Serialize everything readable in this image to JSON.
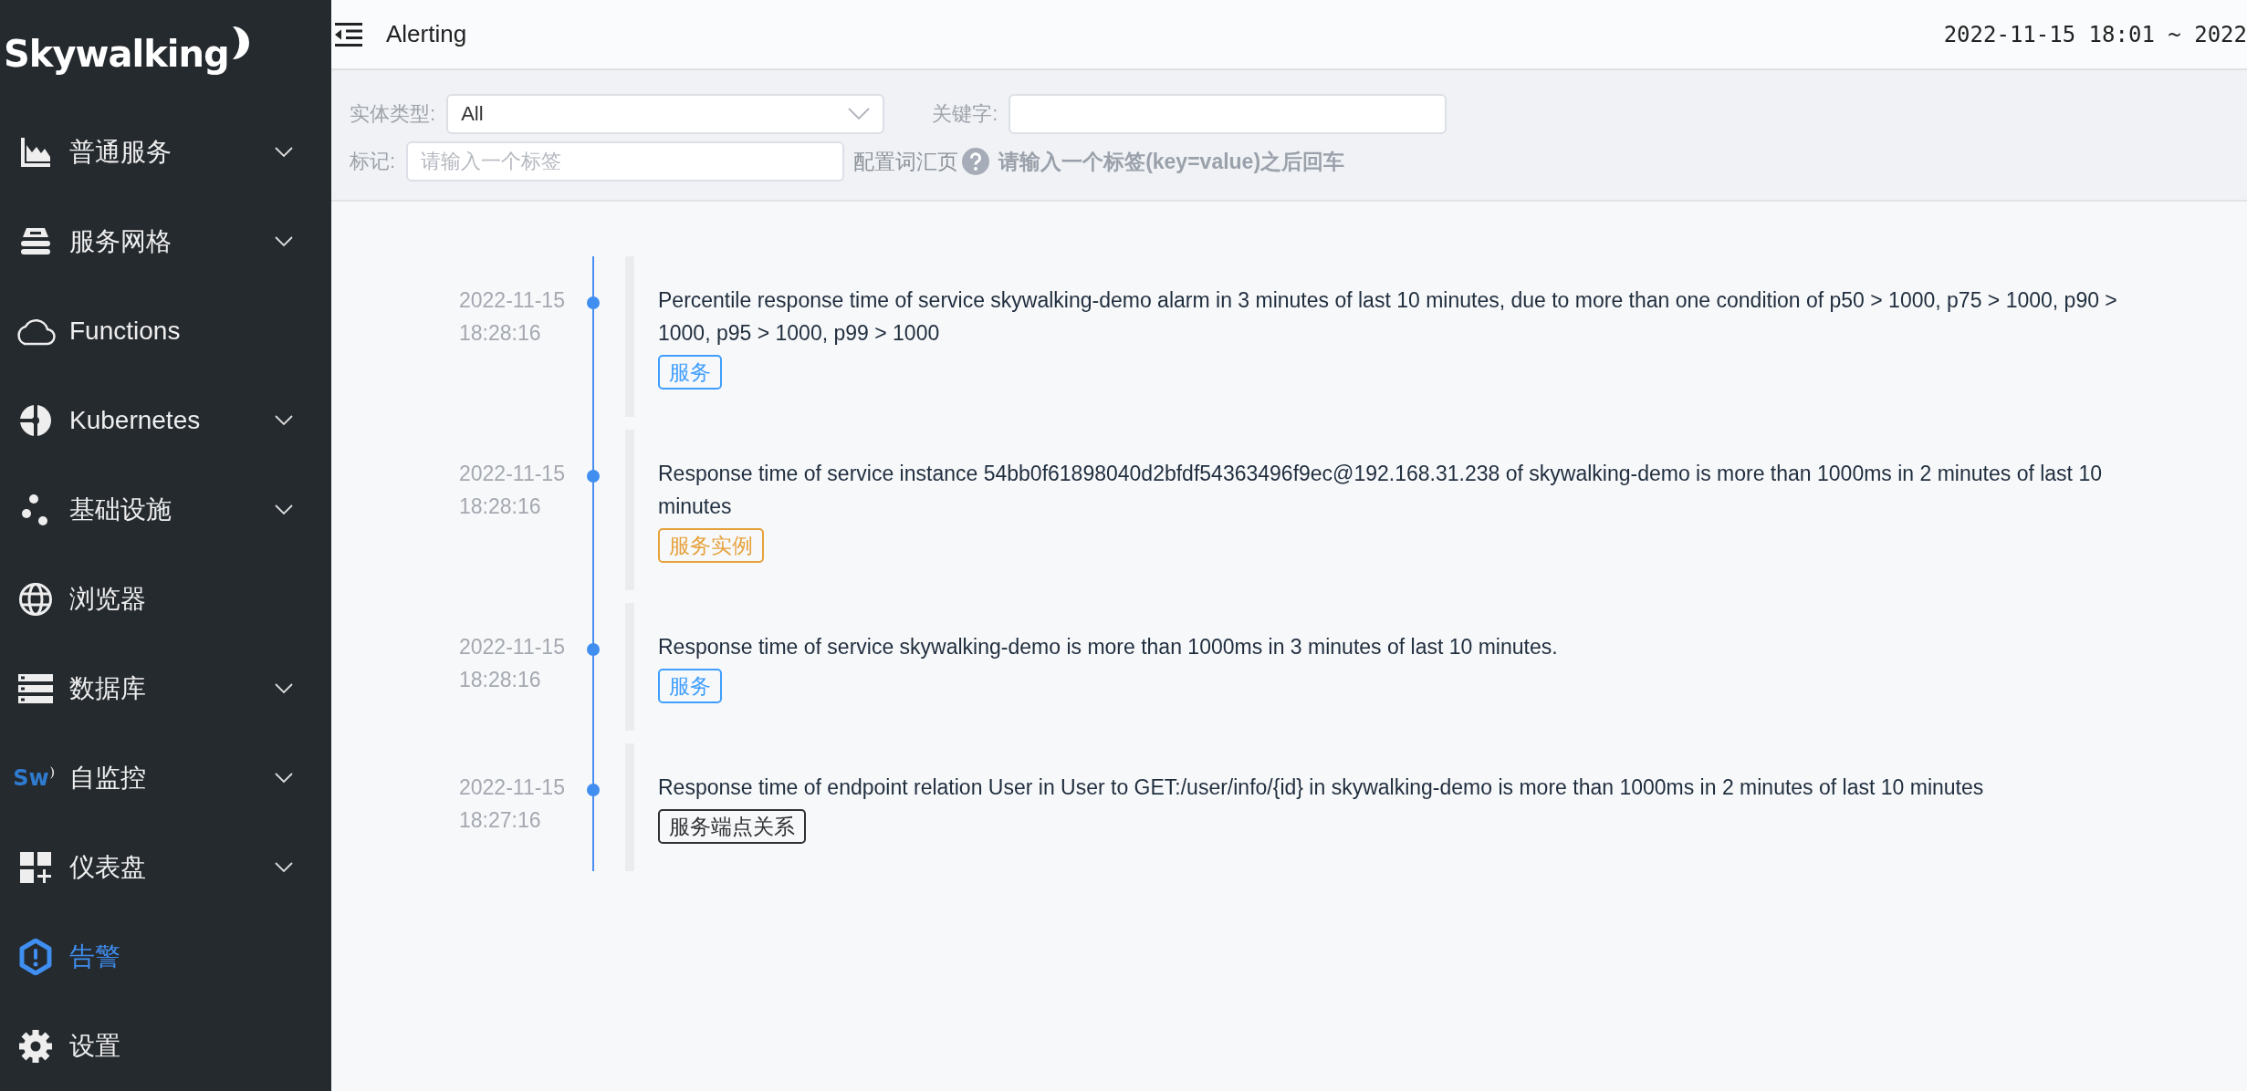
{
  "sidebar": {
    "logo": "Skywalking",
    "items": [
      {
        "kind": "chart",
        "label": "普通服务",
        "expandable": true,
        "selected": false
      },
      {
        "kind": "layers",
        "label": "服务网格",
        "expandable": true,
        "selected": false
      },
      {
        "kind": "cloud",
        "label": "Functions",
        "expandable": false,
        "selected": false
      },
      {
        "kind": "wheel",
        "label": "Kubernetes",
        "expandable": true,
        "selected": false
      },
      {
        "kind": "dots",
        "label": "基础设施",
        "expandable": true,
        "selected": false
      },
      {
        "kind": "globe",
        "label": "浏览器",
        "expandable": false,
        "selected": false
      },
      {
        "kind": "server",
        "label": "数据库",
        "expandable": true,
        "selected": false
      },
      {
        "kind": "logo",
        "logo_text": "Sw",
        "label": "自监控",
        "expandable": true,
        "selected": false
      },
      {
        "kind": "grid",
        "label": "仪表盘",
        "expandable": true,
        "selected": false
      },
      {
        "kind": "alert",
        "label": "告警",
        "expandable": false,
        "selected": true
      },
      {
        "kind": "gear",
        "label": "设置",
        "expandable": false,
        "selected": false
      }
    ]
  },
  "header": {
    "title": "Alerting",
    "time_range": "2022-11-15 18:01 ~ 2022"
  },
  "filters": {
    "entity_type": {
      "label": "实体类型:",
      "value": "All"
    },
    "keyword": {
      "label": "关键字:"
    },
    "tags": {
      "label": "标记:",
      "placeholder": "请输入一个标签"
    },
    "vocabulary_link": "配置词汇页",
    "hint": "请输入一个标签(key=value)之后回车"
  },
  "alarms": [
    {
      "date": "2022-11-15",
      "time": "18:28:16",
      "message": "Percentile response time of service skywalking-demo alarm in 3 minutes of last 10 minutes, due to more than one condition of p50 > 1000, p75 > 1000, p90 > 1000, p95 > 1000, p99 > 1000",
      "tag": "服务",
      "color": "#409eff"
    },
    {
      "date": "2022-11-15",
      "time": "18:28:16",
      "message": "Response time of service instance 54bb0f61898040d2bfdf54363496f9ec@192.168.31.238 of skywalking-demo is more than 1000ms in 2 minutes of last 10 minutes",
      "tag": "服务实例",
      "color": "#e6a23c"
    },
    {
      "date": "2022-11-15",
      "time": "18:28:16",
      "message": "Response time of service skywalking-demo is more than 1000ms in 3 minutes of last 10 minutes.",
      "tag": "服务",
      "color": "#409eff"
    },
    {
      "date": "2022-11-15",
      "time": "18:27:16",
      "message": "Response time of endpoint relation User in User to GET:/user/info/{id} in skywalking-demo is more than 1000ms in 2 minutes of last 10 minutes",
      "tag": "服务端点关系",
      "color": "#303133"
    }
  ]
}
